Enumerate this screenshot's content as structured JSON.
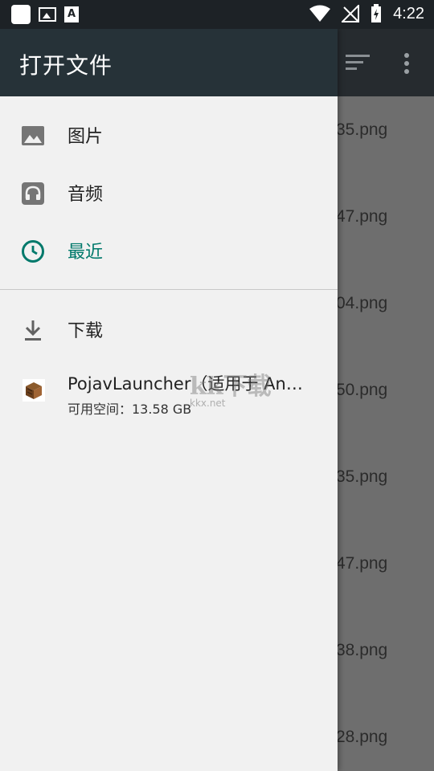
{
  "status_bar": {
    "time": "4:22",
    "notification_a": "A"
  },
  "drawer": {
    "title": "打开文件",
    "items": [
      {
        "label": "图片",
        "icon": "image-icon"
      },
      {
        "label": "音频",
        "icon": "headphones-icon"
      },
      {
        "label": "最近",
        "icon": "clock-icon",
        "active": true
      },
      {
        "label": "下载",
        "icon": "download-icon"
      }
    ],
    "volume": {
      "title": "PojavLauncher（适用于 An…",
      "subtitle": "可用空间：13.58 GB"
    },
    "accent": "#00796b"
  },
  "background_files": [
    "35.png",
    "47.png",
    "04.png",
    "50.png",
    "35.png",
    "47.png",
    "38.png",
    "28.png"
  ],
  "watermark": {
    "text": "kk下载",
    "domain": "kkx.net"
  }
}
